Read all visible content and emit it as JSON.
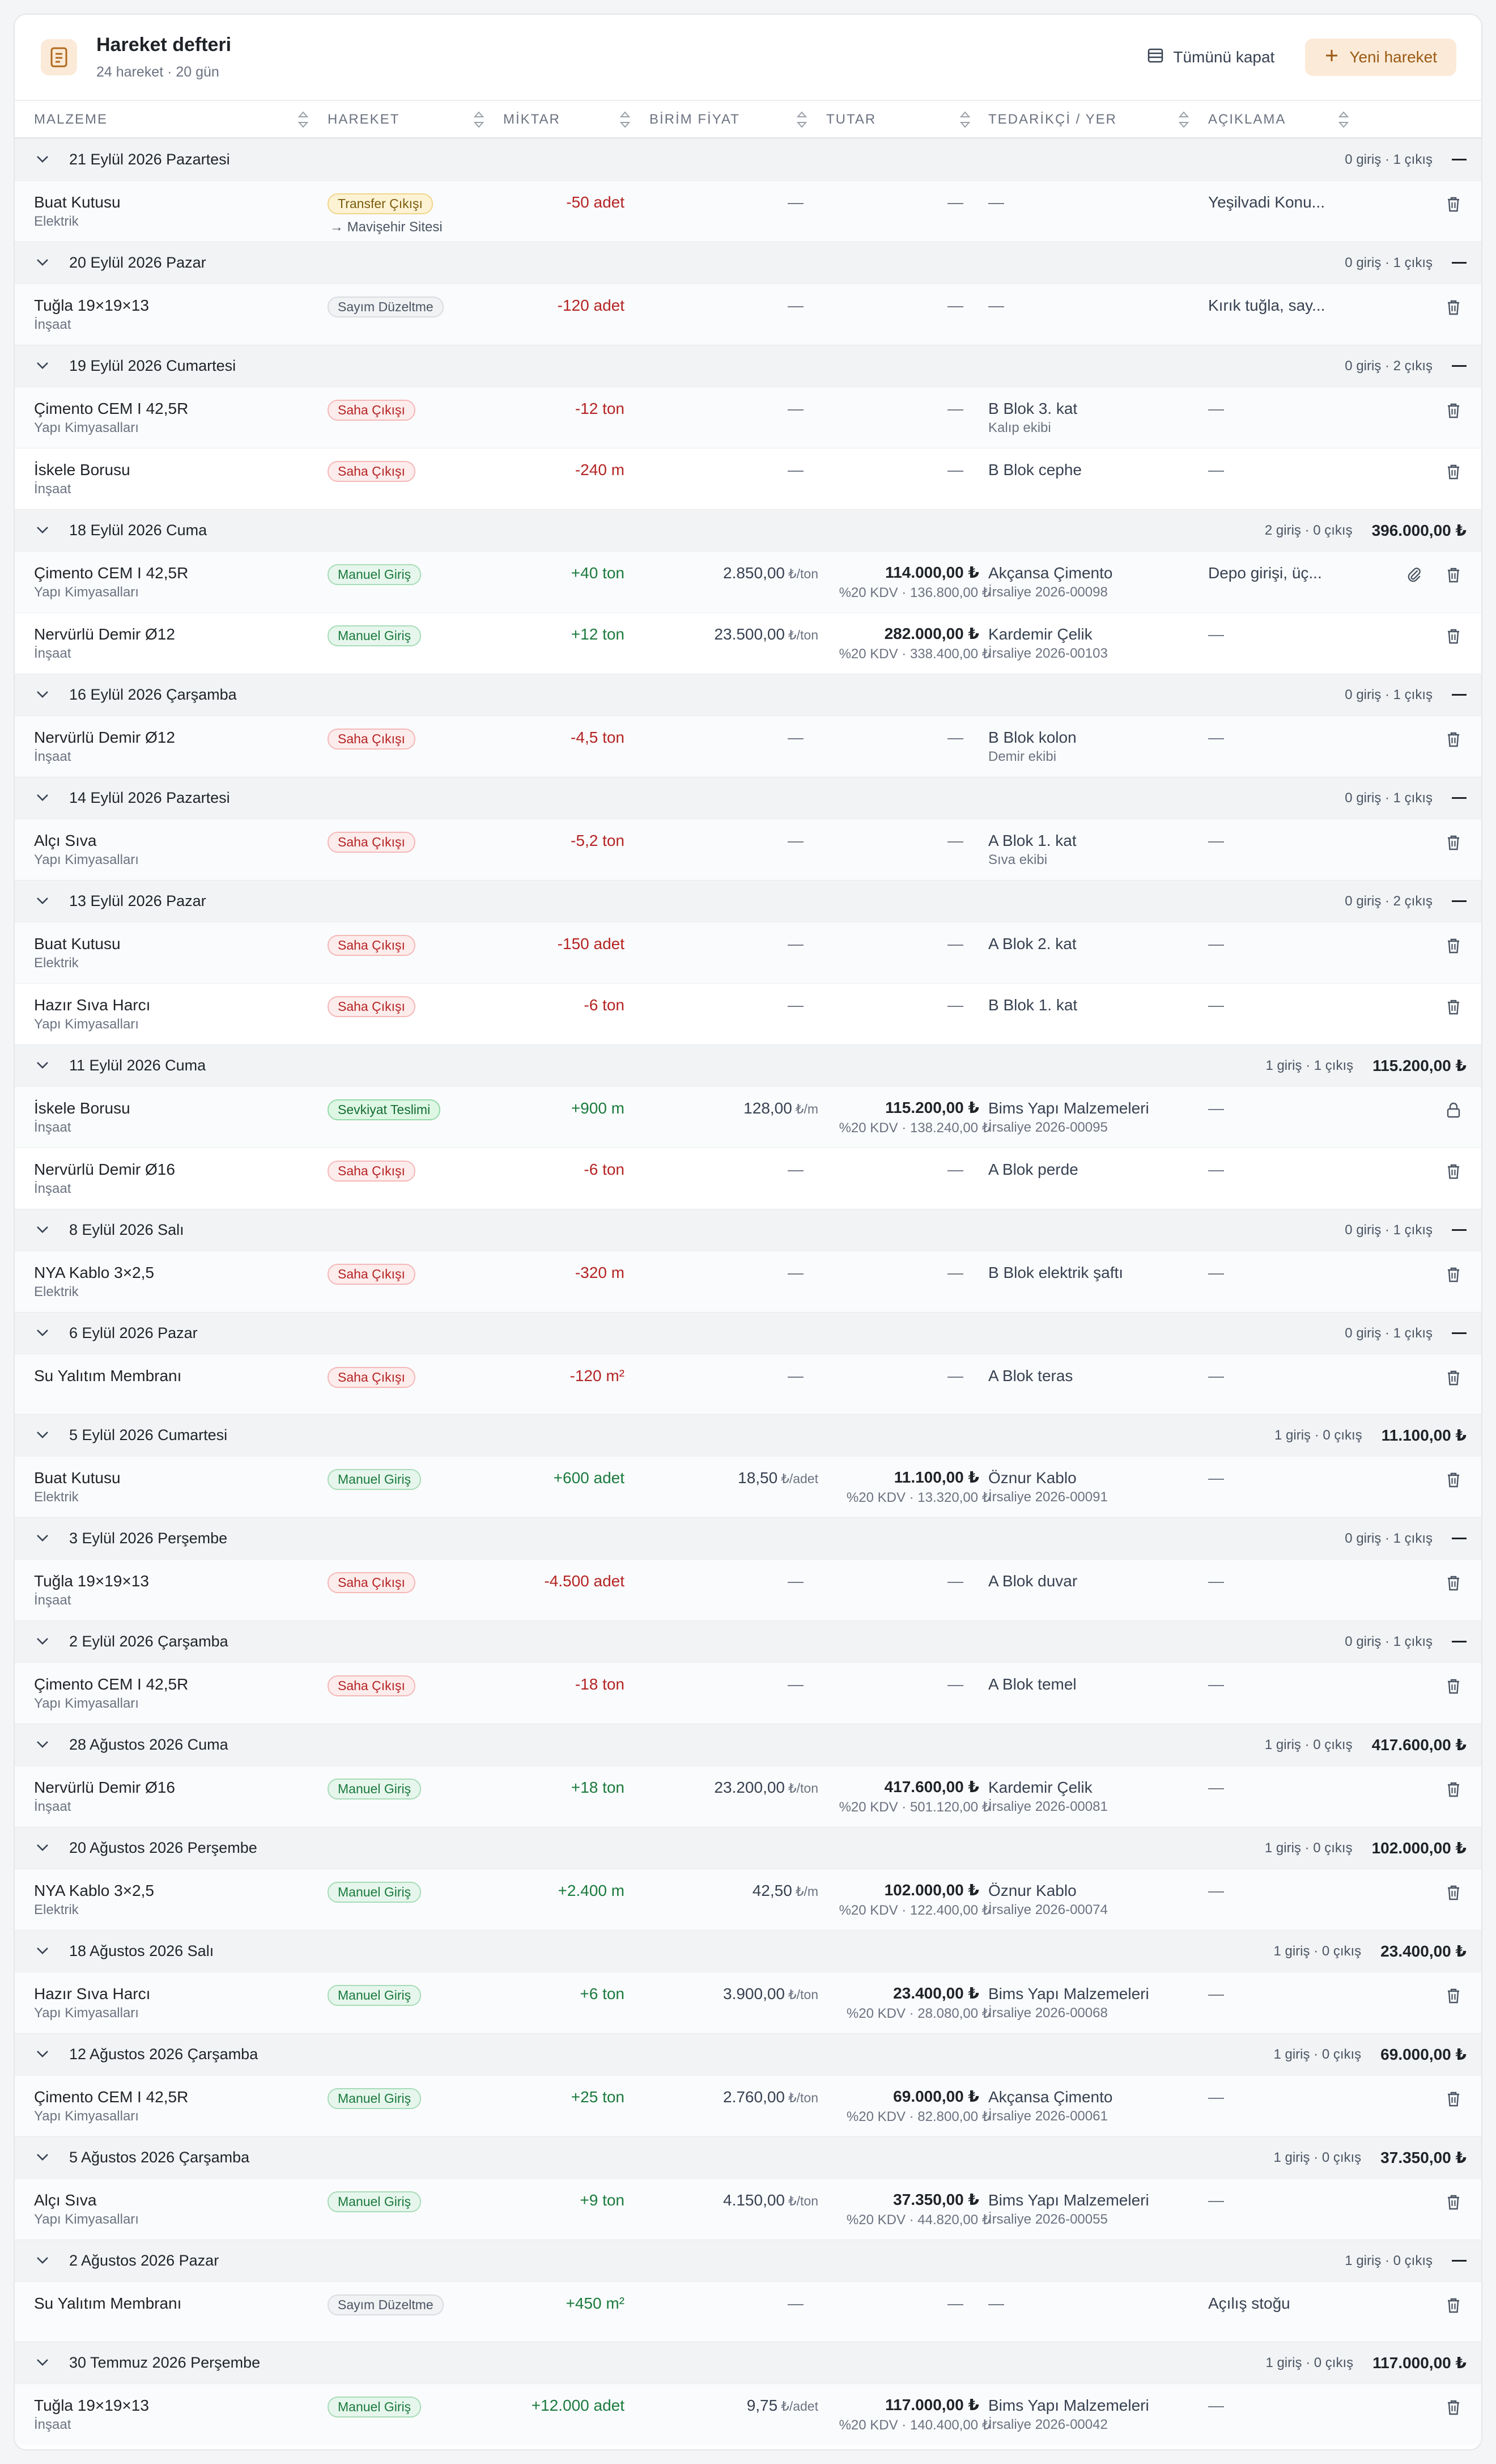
{
  "header": {
    "title": "Hareket defteri",
    "subtitle": "24 hareket · 20 gün",
    "collapse_label": "Tümünü kapat",
    "new_label": "Yeni hareket"
  },
  "columns": [
    "MALZEME",
    "HAREKET",
    "MİKTAR",
    "BİRİM FİYAT",
    "TUTAR",
    "TEDARİKÇİ / YER",
    "AÇIKLAMA"
  ],
  "dash": "—",
  "groups": [
    {
      "date": "21 Eylül 2026 Pazartesi",
      "count": "0 giriş · 1 çıkış",
      "total": "",
      "rows": [
        {
          "name": "Buat Kutusu",
          "cat": "Elektrik",
          "type": "Transfer Çıkışı",
          "type_note": "→ Mavişehir Sitesi",
          "qty": "-50 adet",
          "price": "",
          "unit": "",
          "total": "",
          "vat": "",
          "sup": "",
          "sup_note": "",
          "desc": "Yeşilvadi Konu...",
          "attach": false,
          "action": "delete"
        }
      ]
    },
    {
      "date": "20 Eylül 2026 Pazar",
      "count": "0 giriş · 1 çıkış",
      "total": "",
      "rows": [
        {
          "name": "Tuğla 19×19×13",
          "cat": "İnşaat",
          "type": "Sayım Düzeltme",
          "type_note": "",
          "qty": "-120 adet",
          "price": "",
          "unit": "",
          "total": "",
          "vat": "",
          "sup": "",
          "sup_note": "",
          "desc": "Kırık tuğla, say...",
          "attach": false,
          "action": "delete"
        }
      ]
    },
    {
      "date": "19 Eylül 2026 Cumartesi",
      "count": "0 giriş · 2 çıkış",
      "total": "",
      "rows": [
        {
          "name": "Çimento CEM I 42,5R",
          "cat": "Yapı Kimyasalları",
          "type": "Saha Çıkışı",
          "type_note": "",
          "qty": "-12 ton",
          "price": "",
          "unit": "",
          "total": "",
          "vat": "",
          "sup": "B Blok 3. kat",
          "sup_note": "Kalıp ekibi",
          "desc": "—",
          "attach": false,
          "action": "delete"
        },
        {
          "name": "İskele Borusu",
          "cat": "İnşaat",
          "type": "Saha Çıkışı",
          "type_note": "",
          "qty": "-240 m",
          "price": "",
          "unit": "",
          "total": "",
          "vat": "",
          "sup": "B Blok cephe",
          "sup_note": "",
          "desc": "—",
          "attach": false,
          "action": "delete"
        }
      ]
    },
    {
      "date": "18 Eylül 2026 Cuma",
      "count": "2 giriş · 0 çıkış",
      "total": "396.000,00 ₺",
      "rows": [
        {
          "name": "Çimento CEM I 42,5R",
          "cat": "Yapı Kimyasalları",
          "type": "Manuel Giriş",
          "type_note": "",
          "qty": "+40 ton",
          "price": "2.850,00",
          "unit": "₺/ton",
          "total": "114.000,00 ₺",
          "vat": "%20 KDV · 136.800,00 ₺",
          "sup": "Akçansa Çimento",
          "sup_note": "İrsaliye 2026-00098",
          "desc": "Depo girişi, üç...",
          "attach": true,
          "action": "delete"
        },
        {
          "name": "Nervürlü Demir Ø12",
          "cat": "İnşaat",
          "type": "Manuel Giriş",
          "type_note": "",
          "qty": "+12 ton",
          "price": "23.500,00",
          "unit": "₺/ton",
          "total": "282.000,00 ₺",
          "vat": "%20 KDV · 338.400,00 ₺",
          "sup": "Kardemir Çelik",
          "sup_note": "İrsaliye 2026-00103",
          "desc": "—",
          "attach": false,
          "action": "delete"
        }
      ]
    },
    {
      "date": "16 Eylül 2026 Çarşamba",
      "count": "0 giriş · 1 çıkış",
      "total": "",
      "rows": [
        {
          "name": "Nervürlü Demir Ø12",
          "cat": "İnşaat",
          "type": "Saha Çıkışı",
          "type_note": "",
          "qty": "-4,5 ton",
          "price": "",
          "unit": "",
          "total": "",
          "vat": "",
          "sup": "B Blok kolon",
          "sup_note": "Demir ekibi",
          "desc": "—",
          "attach": false,
          "action": "delete"
        }
      ]
    },
    {
      "date": "14 Eylül 2026 Pazartesi",
      "count": "0 giriş · 1 çıkış",
      "total": "",
      "rows": [
        {
          "name": "Alçı Sıva",
          "cat": "Yapı Kimyasalları",
          "type": "Saha Çıkışı",
          "type_note": "",
          "qty": "-5,2 ton",
          "price": "",
          "unit": "",
          "total": "",
          "vat": "",
          "sup": "A Blok 1. kat",
          "sup_note": "Sıva ekibi",
          "desc": "—",
          "attach": false,
          "action": "delete"
        }
      ]
    },
    {
      "date": "13 Eylül 2026 Pazar",
      "count": "0 giriş · 2 çıkış",
      "total": "",
      "rows": [
        {
          "name": "Buat Kutusu",
          "cat": "Elektrik",
          "type": "Saha Çıkışı",
          "type_note": "",
          "qty": "-150 adet",
          "price": "",
          "unit": "",
          "total": "",
          "vat": "",
          "sup": "A Blok 2. kat",
          "sup_note": "",
          "desc": "—",
          "attach": false,
          "action": "delete"
        },
        {
          "name": "Hazır Sıva Harcı",
          "cat": "Yapı Kimyasalları",
          "type": "Saha Çıkışı",
          "type_note": "",
          "qty": "-6 ton",
          "price": "",
          "unit": "",
          "total": "",
          "vat": "",
          "sup": "B Blok 1. kat",
          "sup_note": "",
          "desc": "—",
          "attach": false,
          "action": "delete"
        }
      ]
    },
    {
      "date": "11 Eylül 2026 Cuma",
      "count": "1 giriş · 1 çıkış",
      "total": "115.200,00 ₺",
      "rows": [
        {
          "name": "İskele Borusu",
          "cat": "İnşaat",
          "type": "Sevkiyat Teslimi",
          "type_note": "",
          "qty": "+900 m",
          "price": "128,00",
          "unit": "₺/m",
          "total": "115.200,00 ₺",
          "vat": "%20 KDV · 138.240,00 ₺",
          "sup": "Bims Yapı Malzemeleri",
          "sup_note": "İrsaliye 2026-00095",
          "desc": "—",
          "attach": false,
          "action": "lock"
        },
        {
          "name": "Nervürlü Demir Ø16",
          "cat": "İnşaat",
          "type": "Saha Çıkışı",
          "type_note": "",
          "qty": "-6 ton",
          "price": "",
          "unit": "",
          "total": "",
          "vat": "",
          "sup": "A Blok perde",
          "sup_note": "",
          "desc": "—",
          "attach": false,
          "action": "delete"
        }
      ]
    },
    {
      "date": "8 Eylül 2026 Salı",
      "count": "0 giriş · 1 çıkış",
      "total": "",
      "rows": [
        {
          "name": "NYA Kablo 3×2,5",
          "cat": "Elektrik",
          "type": "Saha Çıkışı",
          "type_note": "",
          "qty": "-320 m",
          "price": "",
          "unit": "",
          "total": "",
          "vat": "",
          "sup": "B Blok elektrik şaftı",
          "sup_note": "",
          "desc": "—",
          "attach": false,
          "action": "delete"
        }
      ]
    },
    {
      "date": "6 Eylül 2026 Pazar",
      "count": "0 giriş · 1 çıkış",
      "total": "",
      "rows": [
        {
          "name": "Su Yalıtım Membranı",
          "cat": "",
          "type": "Saha Çıkışı",
          "type_note": "",
          "qty": "-120 m²",
          "price": "",
          "unit": "",
          "total": "",
          "vat": "",
          "sup": "A Blok teras",
          "sup_note": "",
          "desc": "—",
          "attach": false,
          "action": "delete"
        }
      ]
    },
    {
      "date": "5 Eylül 2026 Cumartesi",
      "count": "1 giriş · 0 çıkış",
      "total": "11.100,00 ₺",
      "rows": [
        {
          "name": "Buat Kutusu",
          "cat": "Elektrik",
          "type": "Manuel Giriş",
          "type_note": "",
          "qty": "+600 adet",
          "price": "18,50",
          "unit": "₺/adet",
          "total": "11.100,00 ₺",
          "vat": "%20 KDV · 13.320,00 ₺",
          "sup": "Öznur Kablo",
          "sup_note": "İrsaliye 2026-00091",
          "desc": "—",
          "attach": false,
          "action": "delete"
        }
      ]
    },
    {
      "date": "3 Eylül 2026 Perşembe",
      "count": "0 giriş · 1 çıkış",
      "total": "",
      "rows": [
        {
          "name": "Tuğla 19×19×13",
          "cat": "İnşaat",
          "type": "Saha Çıkışı",
          "type_note": "",
          "qty": "-4.500 adet",
          "price": "",
          "unit": "",
          "total": "",
          "vat": "",
          "sup": "A Blok duvar",
          "sup_note": "",
          "desc": "—",
          "attach": false,
          "action": "delete"
        }
      ]
    },
    {
      "date": "2 Eylül 2026 Çarşamba",
      "count": "0 giriş · 1 çıkış",
      "total": "",
      "rows": [
        {
          "name": "Çimento CEM I 42,5R",
          "cat": "Yapı Kimyasalları",
          "type": "Saha Çıkışı",
          "type_note": "",
          "qty": "-18 ton",
          "price": "",
          "unit": "",
          "total": "",
          "vat": "",
          "sup": "A Blok temel",
          "sup_note": "",
          "desc": "—",
          "attach": false,
          "action": "delete"
        }
      ]
    },
    {
      "date": "28 Ağustos 2026 Cuma",
      "count": "1 giriş · 0 çıkış",
      "total": "417.600,00 ₺",
      "rows": [
        {
          "name": "Nervürlü Demir Ø16",
          "cat": "İnşaat",
          "type": "Manuel Giriş",
          "type_note": "",
          "qty": "+18 ton",
          "price": "23.200,00",
          "unit": "₺/ton",
          "total": "417.600,00 ₺",
          "vat": "%20 KDV · 501.120,00 ₺",
          "sup": "Kardemir Çelik",
          "sup_note": "İrsaliye 2026-00081",
          "desc": "—",
          "attach": false,
          "action": "delete"
        }
      ]
    },
    {
      "date": "20 Ağustos 2026 Perşembe",
      "count": "1 giriş · 0 çıkış",
      "total": "102.000,00 ₺",
      "rows": [
        {
          "name": "NYA Kablo 3×2,5",
          "cat": "Elektrik",
          "type": "Manuel Giriş",
          "type_note": "",
          "qty": "+2.400 m",
          "price": "42,50",
          "unit": "₺/m",
          "total": "102.000,00 ₺",
          "vat": "%20 KDV · 122.400,00 ₺",
          "sup": "Öznur Kablo",
          "sup_note": "İrsaliye 2026-00074",
          "desc": "—",
          "attach": false,
          "action": "delete"
        }
      ]
    },
    {
      "date": "18 Ağustos 2026 Salı",
      "count": "1 giriş · 0 çıkış",
      "total": "23.400,00 ₺",
      "rows": [
        {
          "name": "Hazır Sıva Harcı",
          "cat": "Yapı Kimyasalları",
          "type": "Manuel Giriş",
          "type_note": "",
          "qty": "+6 ton",
          "price": "3.900,00",
          "unit": "₺/ton",
          "total": "23.400,00 ₺",
          "vat": "%20 KDV · 28.080,00 ₺",
          "sup": "Bims Yapı Malzemeleri",
          "sup_note": "İrsaliye 2026-00068",
          "desc": "—",
          "attach": false,
          "action": "delete"
        }
      ]
    },
    {
      "date": "12 Ağustos 2026 Çarşamba",
      "count": "1 giriş · 0 çıkış",
      "total": "69.000,00 ₺",
      "rows": [
        {
          "name": "Çimento CEM I 42,5R",
          "cat": "Yapı Kimyasalları",
          "type": "Manuel Giriş",
          "type_note": "",
          "qty": "+25 ton",
          "price": "2.760,00",
          "unit": "₺/ton",
          "total": "69.000,00 ₺",
          "vat": "%20 KDV · 82.800,00 ₺",
          "sup": "Akçansa Çimento",
          "sup_note": "İrsaliye 2026-00061",
          "desc": "—",
          "attach": false,
          "action": "delete"
        }
      ]
    },
    {
      "date": "5 Ağustos 2026 Çarşamba",
      "count": "1 giriş · 0 çıkış",
      "total": "37.350,00 ₺",
      "rows": [
        {
          "name": "Alçı Sıva",
          "cat": "Yapı Kimyasalları",
          "type": "Manuel Giriş",
          "type_note": "",
          "qty": "+9 ton",
          "price": "4.150,00",
          "unit": "₺/ton",
          "total": "37.350,00 ₺",
          "vat": "%20 KDV · 44.820,00 ₺",
          "sup": "Bims Yapı Malzemeleri",
          "sup_note": "İrsaliye 2026-00055",
          "desc": "—",
          "attach": false,
          "action": "delete"
        }
      ]
    },
    {
      "date": "2 Ağustos 2026 Pazar",
      "count": "1 giriş · 0 çıkış",
      "total": "",
      "rows": [
        {
          "name": "Su Yalıtım Membranı",
          "cat": "",
          "type": "Sayım Düzeltme",
          "type_note": "",
          "qty": "+450 m²",
          "price": "",
          "unit": "",
          "total": "",
          "vat": "",
          "sup": "",
          "sup_note": "",
          "desc": "Açılış stoğu",
          "attach": false,
          "action": "delete"
        }
      ]
    },
    {
      "date": "30 Temmuz 2026 Perşembe",
      "count": "1 giriş · 0 çıkış",
      "total": "117.000,00 ₺",
      "rows": [
        {
          "name": "Tuğla 19×19×13",
          "cat": "İnşaat",
          "type": "Manuel Giriş",
          "type_note": "",
          "qty": "+12.000 adet",
          "price": "9,75",
          "unit": "₺/adet",
          "total": "117.000,00 ₺",
          "vat": "%20 KDV · 140.400,00 ₺",
          "sup": "Bims Yapı Malzemeleri",
          "sup_note": "İrsaliye 2026-00042",
          "desc": "—",
          "attach": false,
          "action": "delete"
        }
      ]
    }
  ]
}
